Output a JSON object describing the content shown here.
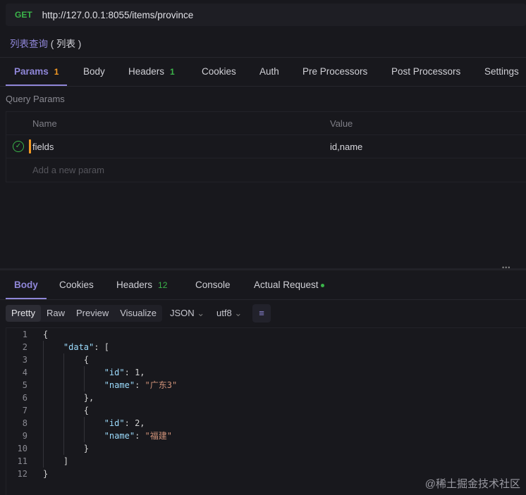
{
  "request": {
    "method": "GET",
    "url": "http://127.0.0.1:8055/items/province",
    "name": "列表查询",
    "name_suffix": "( 列表 )"
  },
  "request_tabs": [
    {
      "label": "Params",
      "badge": "1"
    },
    {
      "label": "Body"
    },
    {
      "label": "Headers",
      "badge": "1"
    },
    {
      "label": "Cookies"
    },
    {
      "label": "Auth"
    },
    {
      "label": "Pre Processors"
    },
    {
      "label": "Post Processors"
    },
    {
      "label": "Settings"
    }
  ],
  "query_params": {
    "title": "Query Params",
    "col_name": "Name",
    "col_value": "Value",
    "rows": [
      {
        "name": "fields",
        "value": "id,name",
        "enabled": true
      }
    ],
    "placeholder": "Add a new param"
  },
  "response_tabs": [
    {
      "label": "Body"
    },
    {
      "label": "Cookies"
    },
    {
      "label": "Headers",
      "badge": "12"
    },
    {
      "label": "Console"
    },
    {
      "label": "Actual Request"
    }
  ],
  "view_modes": [
    "Pretty",
    "Raw",
    "Preview",
    "Visualize"
  ],
  "format": "JSON",
  "encoding": "utf8",
  "code_lines": [
    "1",
    "2",
    "3",
    "4",
    "5",
    "6",
    "7",
    "8",
    "9",
    "10",
    "11",
    "12"
  ],
  "json": {
    "k_data": "\"data\"",
    "k_id": "\"id\"",
    "k_name": "\"name\"",
    "id1": "1",
    "name1": "\"广东3\"",
    "id2": "2",
    "name2": "\"福建\""
  },
  "watermark": "@稀土掘金技术社区",
  "colors": {
    "accent": "#8f86d8",
    "get": "#3bb54a",
    "warn": "#f59a23"
  }
}
